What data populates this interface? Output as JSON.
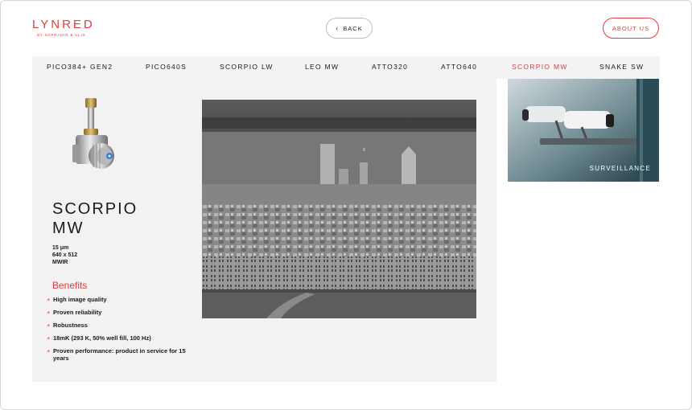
{
  "brand": {
    "name": "LYNRED",
    "tagline": "BY SOFRADIR & ULIS",
    "color": "#e03d3d"
  },
  "header": {
    "back_label": "BACK",
    "about_label": "ABOUT US"
  },
  "nav": {
    "items": [
      {
        "label": "PICO384+ GEN2",
        "active": false
      },
      {
        "label": "PICO640S",
        "active": false
      },
      {
        "label": "SCORPIO LW",
        "active": false
      },
      {
        "label": "LEO MW",
        "active": false
      },
      {
        "label": "ATTO320",
        "active": false
      },
      {
        "label": "ATTO640",
        "active": false
      },
      {
        "label": "SCORPIO MW",
        "active": true
      },
      {
        "label": "SNAKE SW",
        "active": false
      }
    ]
  },
  "product": {
    "title_line1": "SCORPIO",
    "title_line2": "MW",
    "specs": [
      "15 μm",
      "640 x 512",
      "MWIR"
    ],
    "benefits_title": "Benefits",
    "benefits": [
      "High image quality",
      "Proven reliability",
      "Robustness",
      "18mK (293 K, 50% well fill, 100 Hz)",
      "Proven performance: product in service for 15 years"
    ]
  },
  "application": {
    "label": "SURVEILLANCE"
  },
  "icons": {
    "back": "chevron-left-icon",
    "bullet": "plus-icon"
  }
}
